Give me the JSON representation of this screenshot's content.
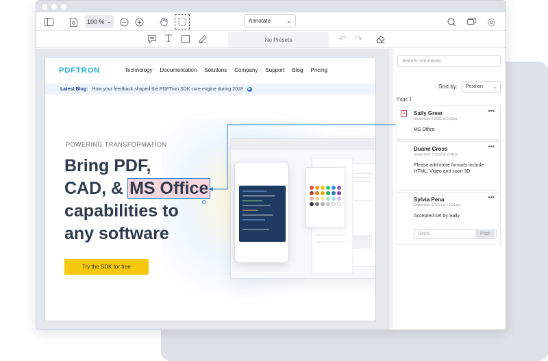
{
  "toolbar": {
    "zoom": "100 %",
    "mode": "Annotate",
    "presets": "No Presets"
  },
  "page": {
    "logo": "PDFTRON",
    "nav": [
      "Technology",
      "Documentation",
      "Solutions",
      "Company",
      "Support",
      "Blog",
      "Pricing"
    ],
    "blog_label": "Latest Blog:",
    "blog_text": "How your feedback shaped the PDFTron SDK core engine during 2018",
    "kicker": "POWERING TRANSFORMATION",
    "headline": [
      "Bring PDF,",
      "CAD, &",
      "MS Office",
      "capabilities to",
      "any software"
    ],
    "cta": "Try the SDK for free"
  },
  "panel": {
    "search_placeholder": "Search comments",
    "sort_label": "Sort by:",
    "sort_value": "Position",
    "page_label": "Page 1",
    "notes": [
      {
        "author": "Sally Greer",
        "date": "September 3 2021 at 2:03pm",
        "body": "MS Office"
      },
      {
        "author": "Duane Cross",
        "date": "September 3 2019 at 2:04pm",
        "body": "Please add more formats include HTML, Video and soon 3D"
      },
      {
        "author": "Sylvia Pena",
        "date": "September 4 2019 at 10:04am",
        "body": "Accepted set by Sally"
      }
    ],
    "reply_placeholder": "Reply",
    "post_label": "Post"
  },
  "colors": {
    "accent": "#2d7dd2",
    "highlight": "#f8d6df",
    "cta": "#f6c90e",
    "logo": "#1bb0d8"
  }
}
